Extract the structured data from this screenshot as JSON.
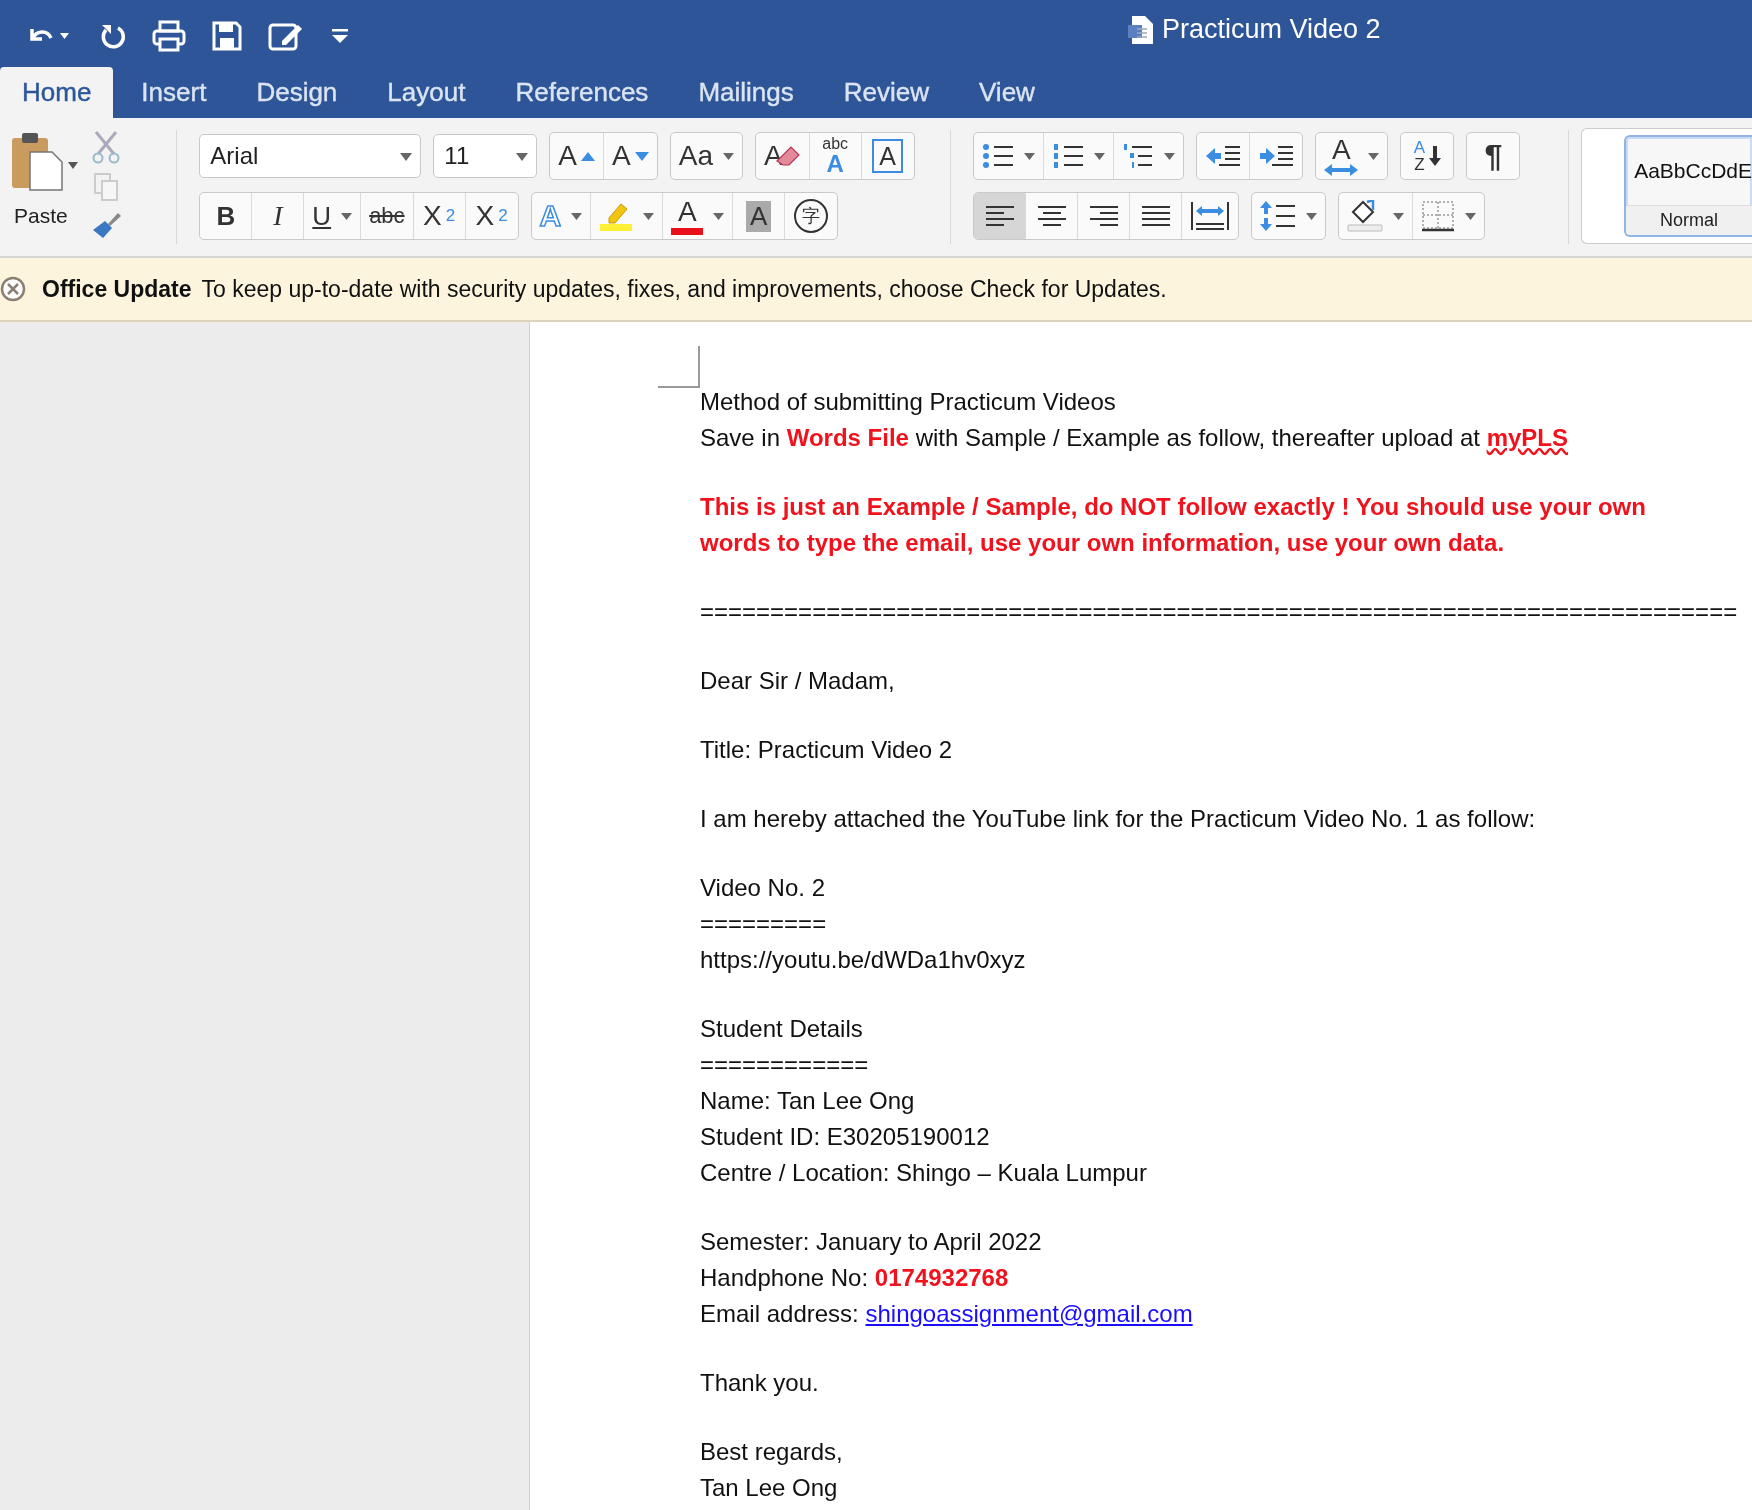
{
  "window": {
    "title": "Practicum Video 2"
  },
  "tabs": [
    {
      "label": "Home",
      "selected": true
    },
    {
      "label": "Insert",
      "selected": false
    },
    {
      "label": "Design",
      "selected": false
    },
    {
      "label": "Layout",
      "selected": false
    },
    {
      "label": "References",
      "selected": false
    },
    {
      "label": "Mailings",
      "selected": false
    },
    {
      "label": "Review",
      "selected": false
    },
    {
      "label": "View",
      "selected": false
    }
  ],
  "clipboard": {
    "paste_label": "Paste"
  },
  "font": {
    "name": "Arial",
    "size": "11"
  },
  "font_row1": [
    {
      "segments": [
        {
          "kind": "grow",
          "glyph": "A"
        },
        {
          "kind": "shrink",
          "glyph": "A"
        }
      ]
    },
    {
      "segments": [
        {
          "kind": "case",
          "glyph": "Aa",
          "dropdown": true
        }
      ]
    },
    {
      "segments": [
        {
          "kind": "clear",
          "glyph": "A"
        },
        {
          "kind": "phonetic",
          "glyph": "abc",
          "sub": "A"
        },
        {
          "kind": "char_border",
          "glyph": "A"
        }
      ]
    }
  ],
  "font_row2": [
    {
      "segments": [
        {
          "kind": "bold",
          "glyph": "B"
        },
        {
          "kind": "italic",
          "glyph": "I"
        },
        {
          "kind": "underline",
          "glyph": "U",
          "dropdown": true
        },
        {
          "kind": "strike",
          "glyph": "abc"
        },
        {
          "kind": "subscript",
          "glyph": "X",
          "sub": "2"
        },
        {
          "kind": "superscript",
          "glyph": "X",
          "sub": "2"
        }
      ]
    },
    {
      "segments": [
        {
          "kind": "effects",
          "glyph": "A",
          "dropdown": true
        },
        {
          "kind": "highlight",
          "dropdown": true
        },
        {
          "kind": "font_color",
          "glyph": "A",
          "dropdown": true
        },
        {
          "kind": "shading",
          "glyph": "A"
        },
        {
          "kind": "enclose",
          "glyph": "字"
        }
      ]
    }
  ],
  "para_row1": [
    {
      "segments": [
        {
          "kind": "bullets",
          "dropdown": true
        },
        {
          "kind": "numbering",
          "dropdown": true
        },
        {
          "kind": "multilevel",
          "dropdown": true
        }
      ]
    },
    {
      "segments": [
        {
          "kind": "outdent"
        },
        {
          "kind": "indent"
        }
      ]
    },
    {
      "segments": [
        {
          "kind": "asian",
          "glyph": "A",
          "dropdown": true
        }
      ]
    },
    {
      "segments": [
        {
          "kind": "sort",
          "glyph": "A",
          "sub": "Z"
        }
      ]
    },
    {
      "segments": [
        {
          "kind": "pilcrow",
          "glyph": "¶"
        }
      ]
    }
  ],
  "para_row2": [
    {
      "segments": [
        {
          "kind": "align_left",
          "selected": true
        },
        {
          "kind": "align_center",
          "selected": false
        },
        {
          "kind": "align_right",
          "selected": false
        },
        {
          "kind": "justify",
          "selected": false
        },
        {
          "kind": "distributed",
          "selected": false
        }
      ]
    },
    {
      "segments": [
        {
          "kind": "line_spacing",
          "dropdown": true
        }
      ]
    },
    {
      "segments": [
        {
          "kind": "fill",
          "dropdown": true
        },
        {
          "kind": "borders",
          "dropdown": true
        }
      ]
    }
  ],
  "styles": {
    "preview": "AaBbCcDdE",
    "name": "Normal",
    "selected": true
  },
  "notification": {
    "title": "Office Update",
    "message": "To keep up-to-date with security updates, fixes, and improvements, choose Check for Updates."
  },
  "document": {
    "blocks": [
      {
        "lines": [
          {
            "kind": "plain",
            "text": "Method of submitting Practicum Videos"
          },
          {
            "kind": "plain",
            "text": "Save in **Words File** with Sample / Example as follow, thereafter upload at",
            "flagged": "myPLS"
          }
        ]
      },
      {
        "lines": [
          {
            "kind": "warning",
            "text": "This is just an Example / Sample, do NOT follow exactly ! You should use your own"
          },
          {
            "kind": "warning",
            "text": "words to type the email, use your own information, use your own data."
          }
        ]
      },
      {
        "lines": [
          {
            "kind": "plain",
            "text": "=========================================================================="
          }
        ]
      },
      {
        "lines": [
          {
            "kind": "plain",
            "text": "Dear Sir / Madam,"
          }
        ]
      },
      {
        "lines": [
          {
            "kind": "plain",
            "text": "Title: Practicum Video 2"
          }
        ]
      },
      {
        "lines": [
          {
            "kind": "plain",
            "text": "I am hereby attached the YouTube link for the Practicum Video No. 1 as follow:"
          }
        ]
      },
      {
        "lines": [
          {
            "kind": "plain",
            "text": "Video No. 2"
          },
          {
            "kind": "plain",
            "text": "========="
          },
          {
            "kind": "plain",
            "text": "https://youtu.be/dWDa1hv0xyz"
          }
        ]
      },
      {
        "lines": [
          {
            "kind": "plain",
            "text": "Student Details"
          },
          {
            "kind": "plain",
            "text": "============"
          },
          {
            "kind": "plain",
            "text": "Name: Tan Lee Ong"
          },
          {
            "kind": "plain",
            "text": "Student ID: E30205190012"
          },
          {
            "kind": "plain",
            "text": "Centre / Location: Shingo – Kuala Lumpur"
          }
        ]
      },
      {
        "lines": [
          {
            "kind": "plain",
            "text": "Semester: January to April 2022"
          },
          {
            "kind": "plain",
            "text": "Handphone No: **0174932768**"
          },
          {
            "kind": "plain",
            "text": "Email address:",
            "link": "shingoassignment@gmail.com"
          }
        ]
      },
      {
        "lines": [
          {
            "kind": "plain",
            "text": "Thank you."
          }
        ]
      },
      {
        "lines": [
          {
            "kind": "plain",
            "text": "Best regards,"
          },
          {
            "kind": "plain",
            "text": "Tan Lee Ong"
          }
        ]
      }
    ]
  }
}
